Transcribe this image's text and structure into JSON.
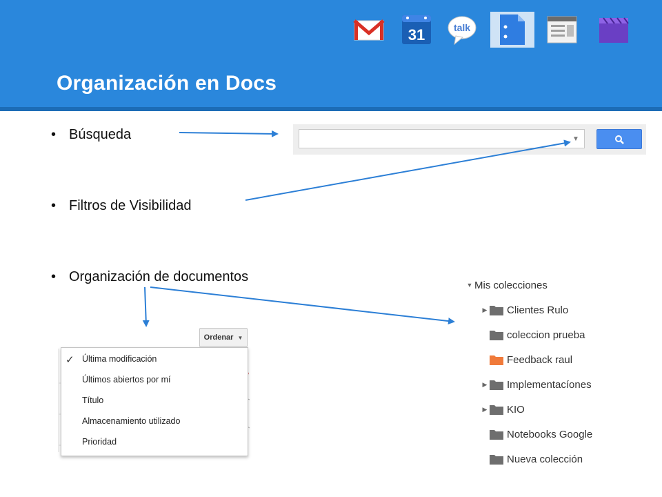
{
  "slide": {
    "title": "Organización en Docs"
  },
  "app_icons": [
    {
      "name": "gmail-icon",
      "active": false
    },
    {
      "name": "calendar-icon",
      "label": "31",
      "active": false
    },
    {
      "name": "talk-icon",
      "label": "talk",
      "active": false
    },
    {
      "name": "docs-icon",
      "active": true
    },
    {
      "name": "sites-icon",
      "active": false
    },
    {
      "name": "video-icon",
      "active": false
    }
  ],
  "bullets": [
    {
      "symbol": "•",
      "text": "Búsqueda"
    },
    {
      "symbol": "•",
      "text": "Filtros de Visibilidad"
    },
    {
      "symbol": "•",
      "text": "Organización de documentos"
    }
  ],
  "search": {
    "value": "",
    "placeholder": "",
    "dropdown_icon": "caret-down-icon",
    "button_icon": "magnifier-icon"
  },
  "sort_menu": {
    "button_label": "Ordenar",
    "items": [
      {
        "label": "Última modificación",
        "checked": true
      },
      {
        "label": "Últimos abiertos por mí",
        "checked": false
      },
      {
        "label": "Título",
        "checked": false
      },
      {
        "label": "Almacenamiento utilizado",
        "checked": false
      },
      {
        "label": "Prioridad",
        "checked": false
      }
    ]
  },
  "collections": {
    "root_label": "Mis colecciones",
    "items": [
      {
        "label": "Clientes Rulo",
        "expandable": true,
        "color": "#6e6e6e"
      },
      {
        "label": "coleccion prueba",
        "expandable": false,
        "color": "#6e6e6e"
      },
      {
        "label": "Feedback raul",
        "expandable": false,
        "color": "#f07a3a"
      },
      {
        "label": "Implementacíones",
        "expandable": true,
        "color": "#6e6e6e"
      },
      {
        "label": "KIO",
        "expandable": true,
        "color": "#6e6e6e"
      },
      {
        "label": "Notebooks Google",
        "expandable": false,
        "color": "#6e6e6e"
      },
      {
        "label": "Nueva colección",
        "expandable": false,
        "color": "#6e6e6e"
      }
    ]
  },
  "colors": {
    "header": "#2a87dc",
    "header_border": "#1c6cb6",
    "arrow": "#2c7fd6",
    "search_button": "#4a8ef0",
    "folder_default": "#6e6e6e",
    "folder_highlight": "#f07a3a"
  }
}
